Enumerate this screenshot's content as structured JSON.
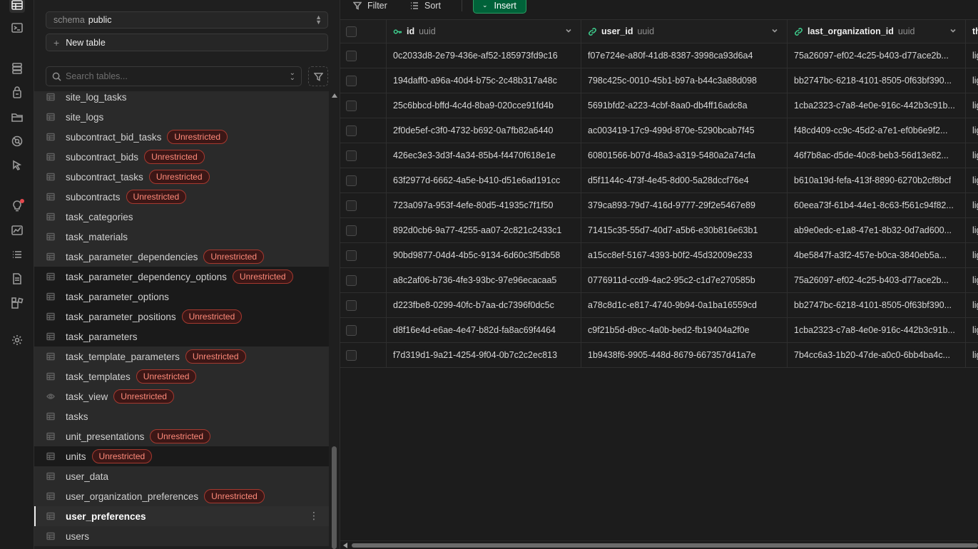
{
  "sidebar": {
    "schema_label": "schema",
    "schema_value": "public",
    "new_table_label": "New table",
    "search_placeholder": "Search tables...",
    "badge_text": "Unrestricted",
    "tables": [
      {
        "name": "site_log_tasks",
        "unrestricted": false,
        "kind": "table"
      },
      {
        "name": "site_logs",
        "unrestricted": false,
        "kind": "table"
      },
      {
        "name": "subcontract_bid_tasks",
        "unrestricted": true,
        "kind": "table"
      },
      {
        "name": "subcontract_bids",
        "unrestricted": true,
        "kind": "table"
      },
      {
        "name": "subcontract_tasks",
        "unrestricted": true,
        "kind": "table"
      },
      {
        "name": "subcontracts",
        "unrestricted": true,
        "kind": "table"
      },
      {
        "name": "task_categories",
        "unrestricted": false,
        "kind": "table"
      },
      {
        "name": "task_materials",
        "unrestricted": false,
        "kind": "table"
      },
      {
        "name": "task_parameter_dependencies",
        "unrestricted": true,
        "kind": "table"
      },
      {
        "name": "task_parameter_dependency_options",
        "unrestricted": true,
        "kind": "table"
      },
      {
        "name": "task_parameter_options",
        "unrestricted": false,
        "kind": "table"
      },
      {
        "name": "task_parameter_positions",
        "unrestricted": true,
        "kind": "table"
      },
      {
        "name": "task_parameters",
        "unrestricted": false,
        "kind": "table"
      },
      {
        "name": "task_template_parameters",
        "unrestricted": true,
        "kind": "table"
      },
      {
        "name": "task_templates",
        "unrestricted": true,
        "kind": "table"
      },
      {
        "name": "task_view",
        "unrestricted": true,
        "kind": "view"
      },
      {
        "name": "tasks",
        "unrestricted": false,
        "kind": "table"
      },
      {
        "name": "unit_presentations",
        "unrestricted": true,
        "kind": "table"
      },
      {
        "name": "units",
        "unrestricted": true,
        "kind": "table"
      },
      {
        "name": "user_data",
        "unrestricted": false,
        "kind": "table"
      },
      {
        "name": "user_organization_preferences",
        "unrestricted": true,
        "kind": "table"
      },
      {
        "name": "user_preferences",
        "unrestricted": false,
        "kind": "table",
        "selected": true
      },
      {
        "name": "users",
        "unrestricted": false,
        "kind": "table"
      }
    ]
  },
  "toolbar": {
    "filter_label": "Filter",
    "sort_label": "Sort",
    "insert_label": "Insert"
  },
  "grid": {
    "columns": [
      {
        "name": "id",
        "type": "uuid",
        "icon": "key-icon"
      },
      {
        "name": "user_id",
        "type": "uuid",
        "icon": "link-icon"
      },
      {
        "name": "last_organization_id",
        "type": "uuid",
        "icon": "link-icon"
      },
      {
        "name": "th",
        "type": "",
        "icon": ""
      }
    ],
    "rows": [
      [
        "0c2033d8-2e79-436e-af52-185973fd9c16",
        "f07e724e-a80f-41d8-8387-3998ca93d6a4",
        "75a26097-ef02-4c25-b403-d77ace2b...",
        "lig"
      ],
      [
        "194daff0-a96a-40d4-b75c-2c48b317a48c",
        "798c425c-0010-45b1-b97a-b44c3a88d098",
        "bb2747bc-6218-4101-8505-0f63bf390...",
        "lig"
      ],
      [
        "25c6bbcd-bffd-4c4d-8ba9-020cce91fd4b",
        "5691bfd2-a223-4cbf-8aa0-db4ff16adc8a",
        "1cba2323-c7a8-4e0e-916c-442b3c91b...",
        "lig"
      ],
      [
        "2f0de5ef-c3f0-4732-b692-0a7fb82a6440",
        "ac003419-17c9-499d-870e-5290bcab7f45",
        "f48cd409-cc9c-45d2-a7e1-ef0b6e9f2...",
        "lig"
      ],
      [
        "426ec3e3-3d3f-4a34-85b4-f4470f618e1e",
        "60801566-b07d-48a3-a319-5480a2a74cfa",
        "46f7b8ac-d5de-40c8-beb3-56d13e82...",
        "lig"
      ],
      [
        "63f2977d-6662-4a5e-b410-d51e6ad191cc",
        "d5f1144c-473f-4e45-8d00-5a28dccf76e4",
        "b610a19d-fefa-413f-8890-6270b2cf8bcf",
        "lig"
      ],
      [
        "723a097a-953f-4efe-80d5-41935c7f1f50",
        "379ca893-79d7-416d-9777-29f2e5467e89",
        "60eea73f-61b4-44e1-8c63-f561c94f82...",
        "lig"
      ],
      [
        "892d0cb6-9a77-4255-aa07-2c821c2433c1",
        "71415c35-55d7-40d7-a5b6-e30b816e63b1",
        "ab9e0edc-e1a8-47e1-8b32-0d7ad600...",
        "lig"
      ],
      [
        "90bd9877-04d4-4b5c-9134-6d60c3f5db58",
        "a15cc8ef-5167-4393-b0f2-45d32009e233",
        "4be5847f-a3f2-457e-b0ca-3840eb5a...",
        "lig"
      ],
      [
        "a8c2af06-b736-4fe3-93bc-97e96ecacaa5",
        "0776911d-ccd9-4ac2-95c2-c1d7e270585b",
        "75a26097-ef02-4c25-b403-d77ace2b...",
        "lig"
      ],
      [
        "d223fbe8-0299-40fc-b7aa-dc7396f0dc5c",
        "a78c8d1c-e817-4740-9b94-0a1ba16559cd",
        "bb2747bc-6218-4101-8505-0f63bf390...",
        "lig"
      ],
      [
        "d8f16e4d-e6ae-4e47-b82d-fa8ac69f4464",
        "c9f21b5d-d9cc-4a0b-bed2-fb19404a2f0e",
        "1cba2323-c7a8-4e0e-916c-442b3c91b...",
        "lig"
      ],
      [
        "f7d319d1-9a21-4254-9f04-0b7c2c2ec813",
        "1b9438f6-9905-448d-8679-667357d41a7e",
        "7b4cc6a3-1b20-47de-a0c0-6bb4ba4c...",
        "lig"
      ]
    ]
  },
  "colors": {
    "accent_green": "#006239",
    "badge_red": "#a5392f",
    "key_icon": "#3ecf8e",
    "link_icon": "#3ecf8e"
  }
}
